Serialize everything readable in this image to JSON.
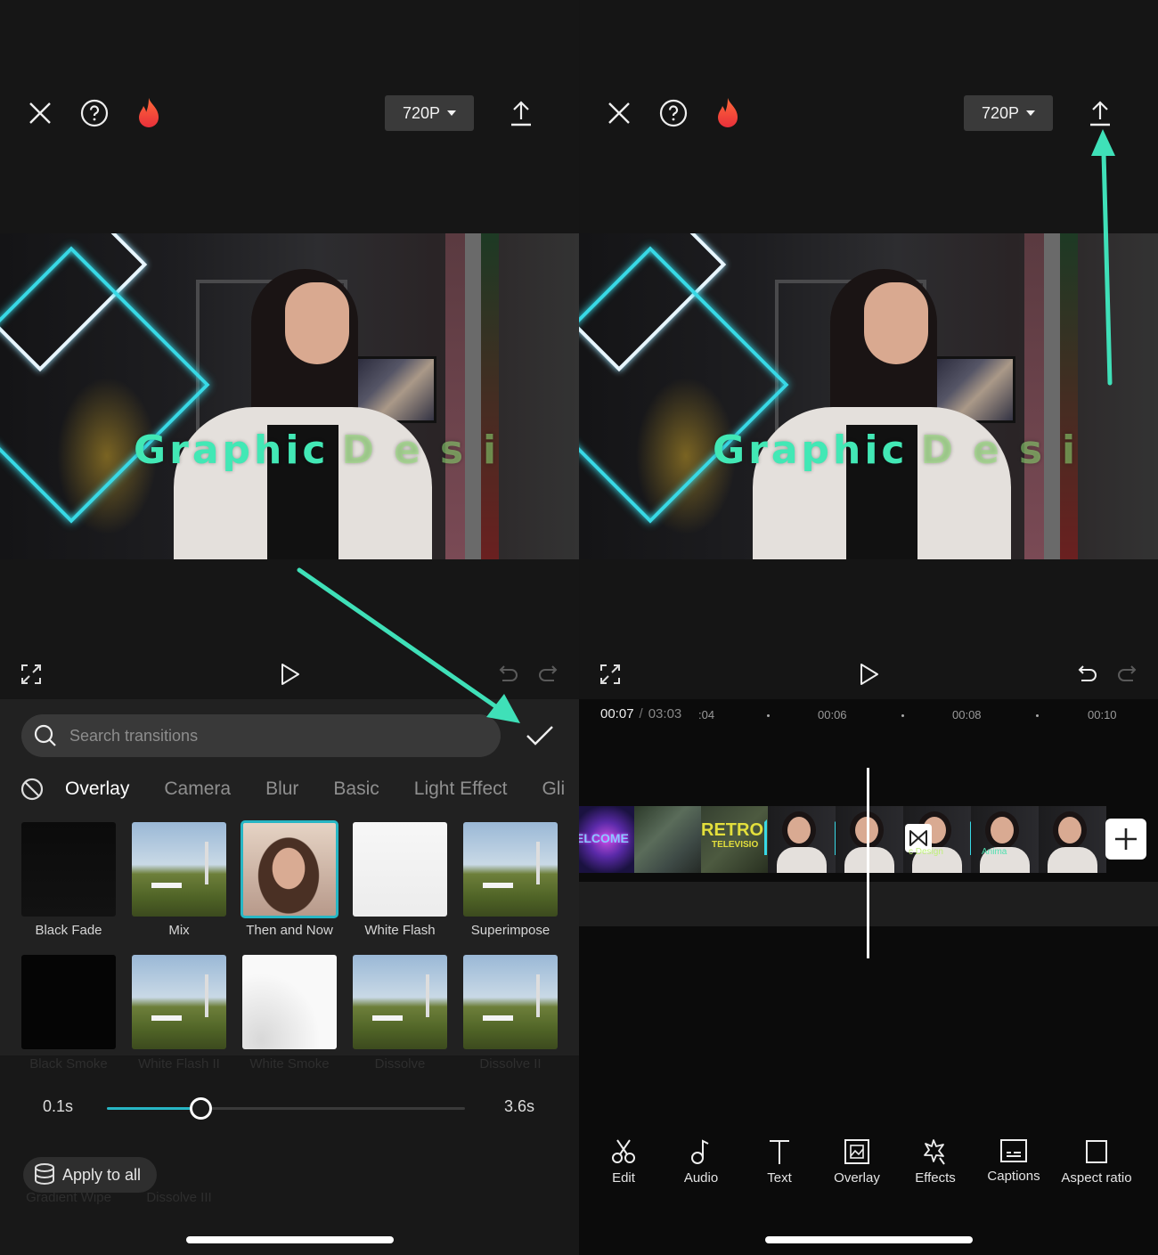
{
  "left": {
    "header": {
      "close_icon": "close-icon",
      "help_icon": "help-icon",
      "pro_icon": "flame-icon",
      "resolution": "720P",
      "export_icon": "export-icon"
    },
    "preview": {
      "overlay_text_main": "Graphic",
      "overlay_text_fading": "Desi"
    },
    "controls": {
      "fullscreen_icon": "fullscreen-icon",
      "play_icon": "play-icon",
      "undo_icon": "undo-icon",
      "redo_icon": "redo-icon",
      "undo_enabled": false,
      "redo_enabled": false
    },
    "transitions": {
      "search_placeholder": "Search transitions",
      "search_value": "",
      "confirm_icon": "check-icon",
      "none_icon": "no-transition-icon",
      "tabs": [
        {
          "label": "Overlay",
          "active": true
        },
        {
          "label": "Camera",
          "active": false
        },
        {
          "label": "Blur",
          "active": false
        },
        {
          "label": "Basic",
          "active": false
        },
        {
          "label": "Light Effect",
          "active": false
        },
        {
          "label": "Gli",
          "active": false
        }
      ],
      "items_row1": [
        {
          "label": "Black Fade",
          "style": "blackfade",
          "selected": false
        },
        {
          "label": "Mix",
          "style": "hollywood",
          "selected": false
        },
        {
          "label": "Then and Now",
          "style": "portrait",
          "selected": true
        },
        {
          "label": "White Flash",
          "style": "white",
          "selected": false
        },
        {
          "label": "Superimpose",
          "style": "hollywood",
          "selected": false
        }
      ],
      "items_row2": [
        {
          "label": "Black Smoke",
          "style": "black"
        },
        {
          "label": "White Flash II",
          "style": "hollywood"
        },
        {
          "label": "White Smoke",
          "style": "whitesmoke"
        },
        {
          "label": "Dissolve",
          "style": "hollywood"
        },
        {
          "label": "Dissolve II",
          "style": "hollywood"
        }
      ],
      "items_row3_labels": [
        "Gradient Wipe",
        "Dissolve III"
      ]
    },
    "duration": {
      "min_label": "0.1s",
      "max_label": "3.6s",
      "value_fraction": 0.26
    },
    "apply_all": {
      "icon": "layers-icon",
      "label": "Apply to all"
    }
  },
  "right": {
    "header": {
      "close_icon": "close-icon",
      "help_icon": "help-icon",
      "pro_icon": "flame-icon",
      "resolution": "720P",
      "export_icon": "export-icon"
    },
    "preview": {
      "overlay_text_main": "Graphic",
      "overlay_text_fading": "Desi"
    },
    "controls": {
      "undo_enabled": true,
      "redo_enabled": false
    },
    "timeline": {
      "current_time": "00:07",
      "separator": "/",
      "total_time": "03:03",
      "ticks": [
        ":04",
        "00:06",
        "00:08",
        "00:10"
      ],
      "clips": [
        {
          "type": "welcome",
          "text": "ELCOME"
        },
        {
          "type": "street",
          "text": ""
        },
        {
          "type": "retro",
          "text": "RETRO",
          "subtext": "TELEVISIO"
        },
        {
          "type": "person",
          "text": ""
        },
        {
          "type": "person",
          "text": ""
        },
        {
          "type": "person",
          "text": "c Design"
        },
        {
          "type": "person",
          "text": "Anima"
        },
        {
          "type": "person",
          "text": ""
        }
      ],
      "transition_icon": "transition-bowtie-icon",
      "add_clip_icon": "plus-icon"
    },
    "toolbar": [
      {
        "label": "Edit",
        "icon": "scissors-icon"
      },
      {
        "label": "Audio",
        "icon": "music-note-icon"
      },
      {
        "label": "Text",
        "icon": "text-icon"
      },
      {
        "label": "Overlay",
        "icon": "overlay-image-icon"
      },
      {
        "label": "Effects",
        "icon": "star-wand-icon"
      },
      {
        "label": "Captions",
        "icon": "captions-icon"
      },
      {
        "label": "Aspect ratio",
        "icon": "aspect-ratio-icon"
      }
    ]
  },
  "annotations": {
    "arrow_color": "#3fe0b8",
    "arrow1": "points to confirm check button",
    "arrow2": "points to export button"
  },
  "colors": {
    "accent": "#27b6c4",
    "panel_bg": "#161616",
    "sheet_bg": "#212121",
    "timeline_bg": "#0b0b0b"
  }
}
